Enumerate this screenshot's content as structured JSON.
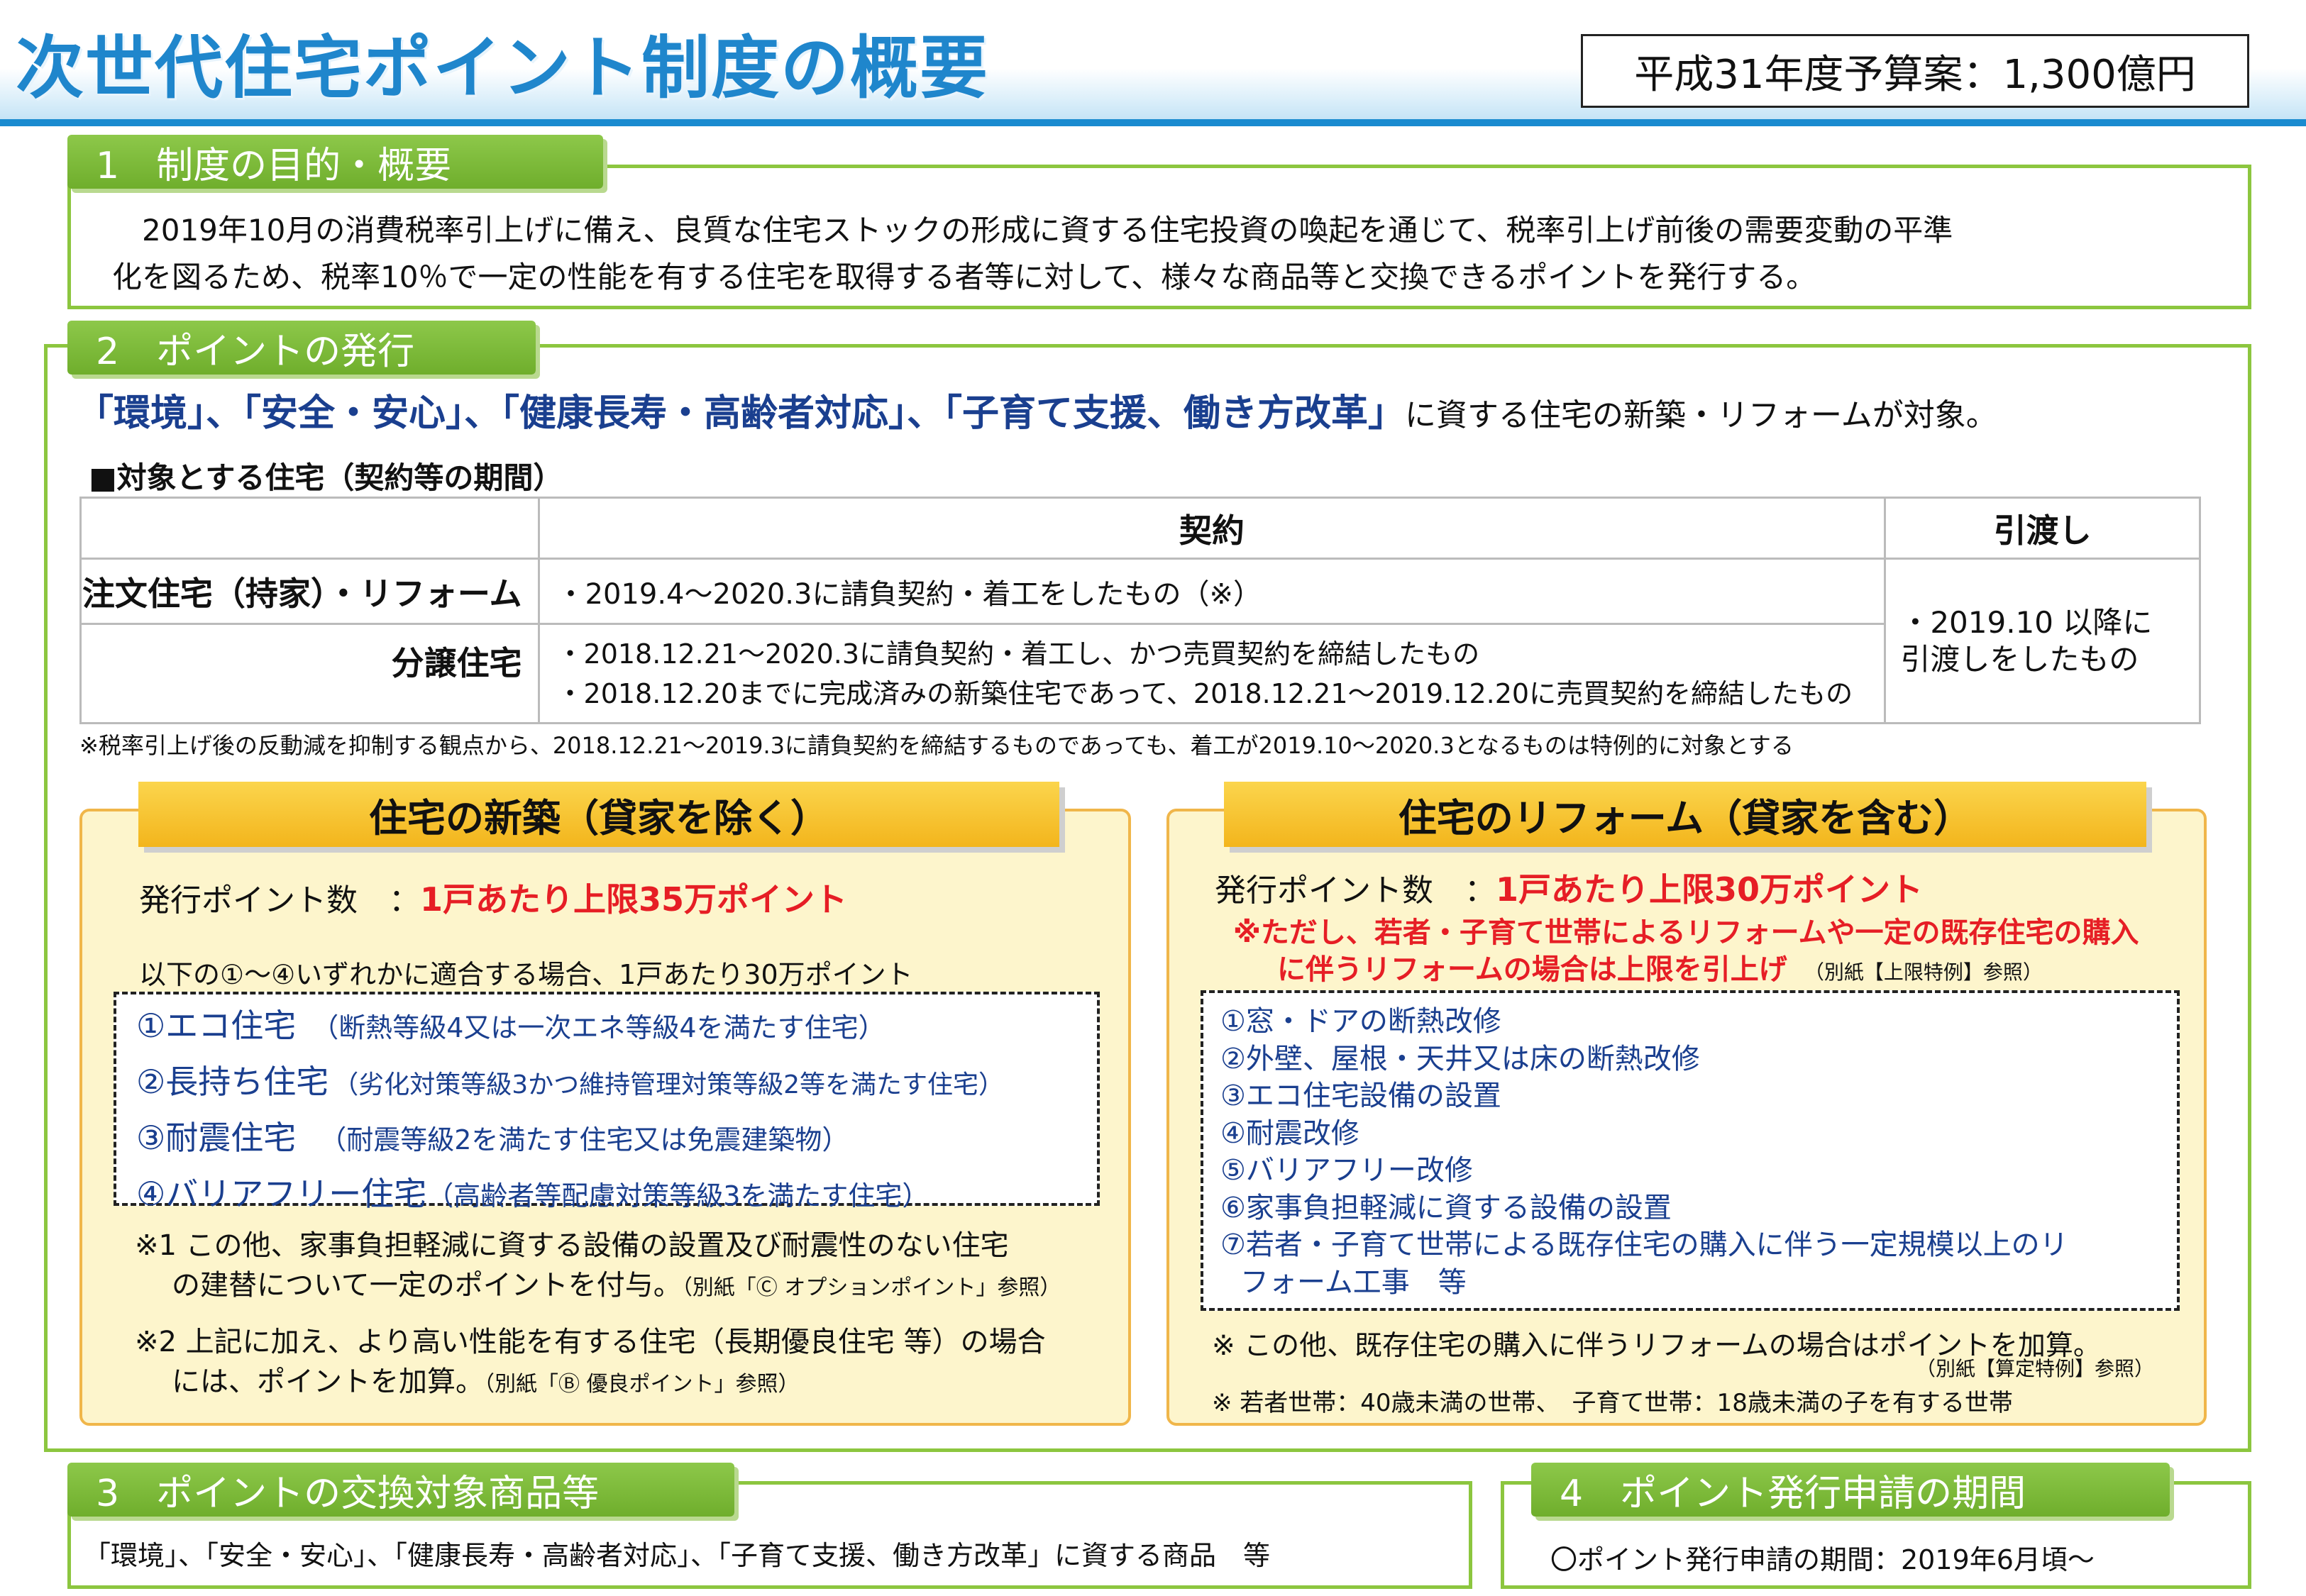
{
  "header": {
    "title": "次世代住宅ポイント制度の概要",
    "budget": "平成31年度予算案：1,300億円"
  },
  "section1": {
    "tab": "1　制度の目的・概要",
    "lines": [
      "　2019年10月の消費税率引上げに備え、良質な住宅ストックの形成に資する住宅投資の喚起を通じて、税率引上げ前後の需要変動の平準",
      "化を図るため、税率10％で一定の性能を有する住宅を取得する者等に対して、様々な商品等と交換できるポイントを発行する。"
    ]
  },
  "section2": {
    "tab": "2　ポイントの発行",
    "intro_emph": "「環境」、「安全・安心」、「健康長寿・高齢者対応」、「子育て支援、働き方改革」",
    "intro_tail": "に資する住宅の新築・リフォームが対象。",
    "table_title": "■対象とする住宅（契約等の期間）",
    "table": {
      "col_contract": "契約",
      "col_delivery": "引渡し",
      "row1_head": "注文住宅（持家）・リフォーム",
      "row1_contract": "・2019.4～2020.3に請負契約・着工をしたもの（※）",
      "row2_head": "分譲住宅",
      "row2_contract_1": "・2018.12.21～2020.3に請負契約・着工し、かつ売買契約を締結したもの",
      "row2_contract_2": "・2018.12.20までに完成済みの新築住宅であって、2018.12.21～2019.12.20に売買契約を締結したもの",
      "delivery_1": "・2019.10 以降に",
      "delivery_2": "引渡しをしたもの"
    },
    "table_note": "※税率引上げ後の反動減を抑制する観点から、2018.12.21～2019.3に請負契約を締結するものであっても、着工が2019.10～2020.3となるものは特例的に対象とする",
    "new_build": {
      "title": "住宅の新築（貸家を除く）",
      "points_label": "発行ポイント数　：",
      "points_value": "1戸あたり上限35万ポイント",
      "sub": "以下の①～④いずれかに適合する場合、1戸あたり30万ポイント",
      "items": [
        {
          "name": "①エコ住宅",
          "desc": "（断熱等級4又は一次エネ等級4を満たす住宅）"
        },
        {
          "name": "②長持ち住宅",
          "desc": "（劣化対策等級3かつ維持管理対策等級2等を満たす住宅）"
        },
        {
          "name": "③耐震住宅",
          "desc": "　（耐震等級2を満たす住宅又は免震建築物）"
        },
        {
          "name": "④バリアフリー住宅",
          "desc": "（高齢者等配慮対策等級3を満たす住宅）"
        }
      ],
      "note1_line1": "※1 この他、家事負担軽減に資する設備の設置及び耐震性のない住宅",
      "note1_line2": "の建替について一定のポイントを付与。",
      "note1_ref": "（別紙「Ⓒ オプションポイント」参照）",
      "note2_line1": "※2 上記に加え、より高い性能を有する住宅（長期優良住宅 等）の場合",
      "note2_line2": "には、ポイントを加算。",
      "note2_ref": "（別紙「Ⓑ 優良ポイント」参照）"
    },
    "reform": {
      "title": "住宅のリフォーム（貸家を含む）",
      "points_label": "発行ポイント数　：",
      "points_value": "1戸あたり上限30万ポイント",
      "red_note_1": "※ただし、若者・子育て世帯によるリフォームや一定の既存住宅の購入",
      "red_note_2": "に伴うリフォームの場合は上限を引上げ",
      "red_note_ref": "（別紙【上限特例】参照）",
      "items": [
        "①窓・ドアの断熱改修",
        "②外壁、屋根・天井又は床の断熱改修",
        "③エコ住宅設備の設置",
        "④耐震改修",
        "⑤バリアフリー改修",
        "⑥家事負担軽減に資する設備の設置",
        "⑦若者・子育て世帯による既存住宅の購入に伴う一定規模以上のリ",
        "フォーム工事　等"
      ],
      "note_1": "※ この他、既存住宅の購入に伴うリフォームの場合はポイントを加算。",
      "note_ref": "（別紙【算定特例】参照）",
      "note_2": "※ 若者世帯：40歳未満の世帯、　子育て世帯：18歳未満の子を有する世帯"
    }
  },
  "section3": {
    "tab": "3　ポイントの交換対象商品等",
    "text": "「環境」、「安全・安心」、「健康長寿・高齢者対応」、「子育て支援、働き方改革」に資する商品　等"
  },
  "section4": {
    "tab": "4　ポイント発行申請の期間",
    "text": "〇ポイント発行申請の期間：2019年6月頃～"
  }
}
